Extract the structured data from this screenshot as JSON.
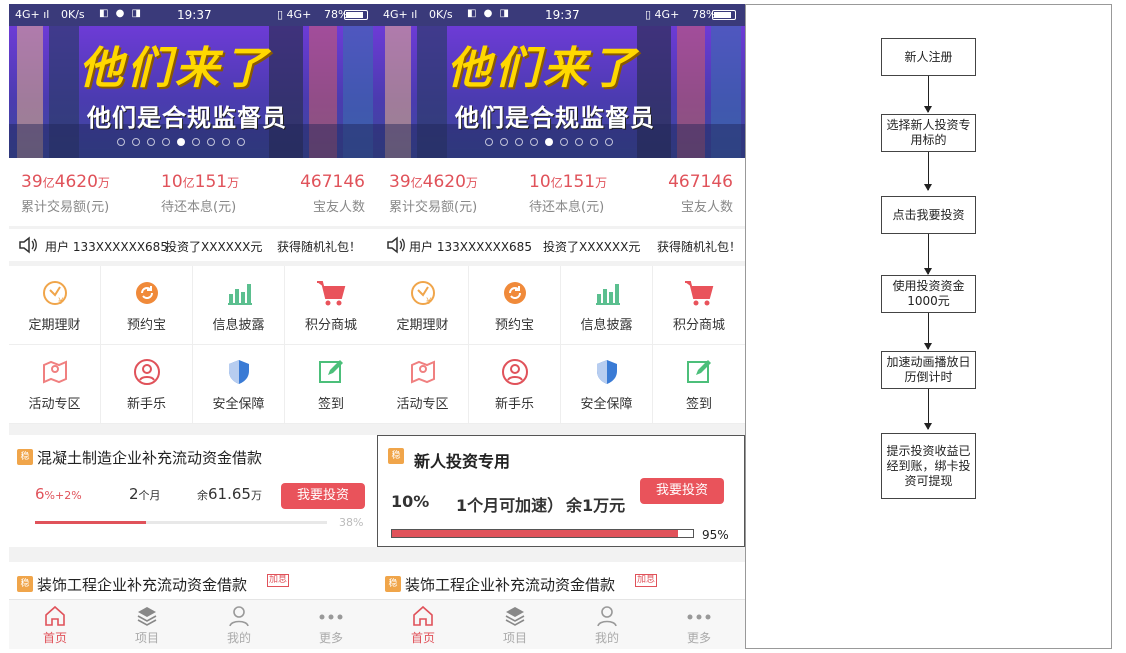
{
  "status_bar": {
    "signal": "4G+ ıl",
    "speed": "0K/s",
    "icons": "◧ ● ◨",
    "time": "19:37",
    "network": "▯ 4G+",
    "battery": "78%"
  },
  "banner": {
    "headline": "他们来了",
    "subtitle": "他们是合规监督员"
  },
  "stats": [
    {
      "num1": "39",
      "unit1": "亿",
      "num2": "4620",
      "unit2": "万",
      "label": "累计交易额(元)"
    },
    {
      "num1": "10",
      "unit1": "亿",
      "num2": "151",
      "unit2": "万",
      "label": "待还本息(元)"
    },
    {
      "num1": "467146",
      "label": "宝友人数"
    }
  ],
  "ticker": {
    "user": "用户 133XXXXXX685",
    "action": "投资了XXXXXX元",
    "reward": "获得随机礼包！"
  },
  "grid": [
    {
      "label": "定期理财",
      "icon": "clock-yen-icon",
      "color": "#f0a54a"
    },
    {
      "label": "预约宝",
      "icon": "refresh-icon",
      "color": "#f08a3a"
    },
    {
      "label": "信息披露",
      "icon": "bar-chart-icon",
      "color": "#5bbf8f"
    },
    {
      "label": "积分商城",
      "icon": "cart-icon",
      "color": "#e9535b"
    },
    {
      "label": "活动专区",
      "icon": "map-pin-icon",
      "color": "#f08080"
    },
    {
      "label": "新手乐",
      "icon": "user-circle-icon",
      "color": "#e0525a"
    },
    {
      "label": "安全保障",
      "icon": "shield-icon",
      "color": "#3a7bd5"
    },
    {
      "label": "签到",
      "icon": "edit-icon",
      "color": "#4cbf7a"
    }
  ],
  "left_card": {
    "badge": "稳",
    "title": "混凝土制造企业补充流动资金借款",
    "rate": "6",
    "rate_suffix": "%+2%",
    "term": "2",
    "term_unit": "个月",
    "remain_prefix": "余",
    "remain": "61.65",
    "remain_unit": "万",
    "button": "我要投资",
    "progress": 38,
    "progress_label": "38%"
  },
  "right_card": {
    "badge": "稳",
    "title": "新人投资专用",
    "rate": "10%",
    "term": "1个月可加速）",
    "remain": "余1万元",
    "button": "我要投资",
    "progress": 95,
    "progress_label": "95%"
  },
  "second_card": {
    "badge": "稳",
    "title": "装饰工程企业补充流动资金借款",
    "tag": "加息"
  },
  "tabs": [
    {
      "label": "首页",
      "icon": "home-icon",
      "active": true
    },
    {
      "label": "项目",
      "icon": "layers-icon",
      "active": false
    },
    {
      "label": "我的",
      "icon": "user-icon",
      "active": false
    },
    {
      "label": "更多",
      "icon": "more-icon",
      "active": false
    }
  ],
  "flow": [
    "新人注册",
    "选择新人投资专用标的",
    "点击我要投资",
    "使用投资资金1000元",
    "加速动画播放日历倒计时",
    "提示投资收益已经到账，绑卡投资可提现"
  ],
  "colors": {
    "accent": "#e0525a",
    "banner": "#5a3bc4",
    "headline": "#ffd800"
  }
}
